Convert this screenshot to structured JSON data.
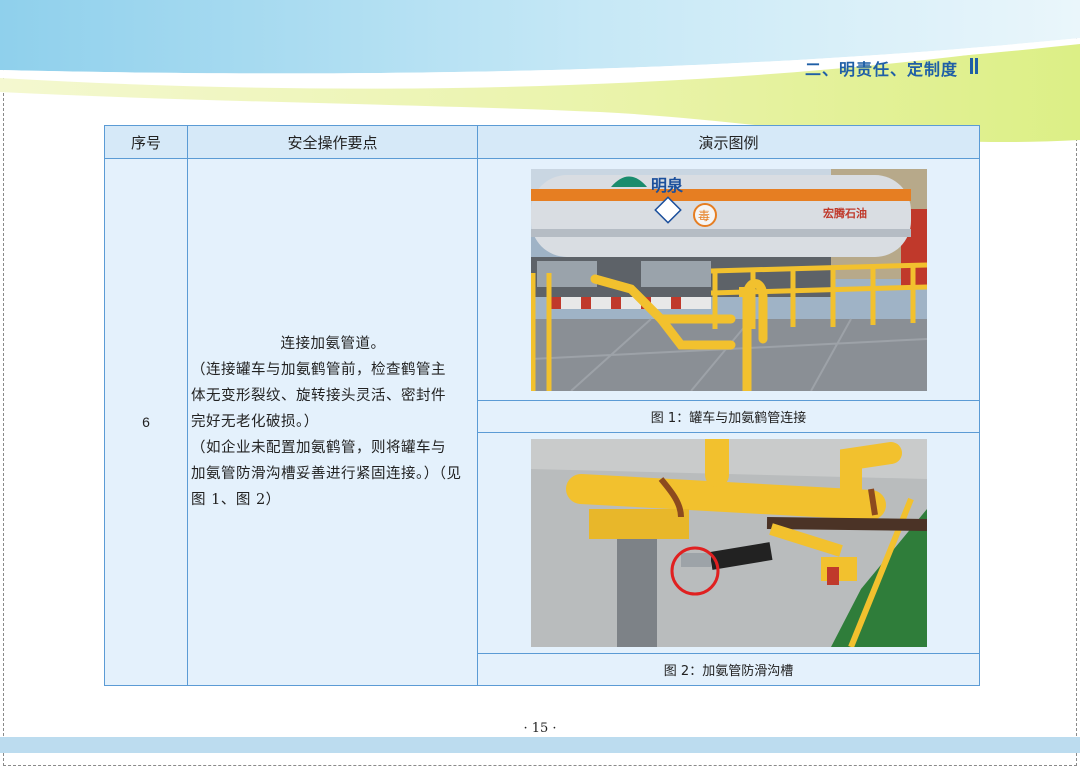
{
  "header": {
    "section_title": "二、明责任、定制度"
  },
  "table": {
    "headers": {
      "no": "序号",
      "points": "安全操作要点",
      "demo": "演示图例"
    },
    "row": {
      "no": "6",
      "points_title": "连接加氨管道。",
      "points_lines": [
        "（连接罐车与加氨鹤管前，检查鹤管主",
        "体无变形裂纹、旋转接头灵活、密封件",
        "完好无老化破损。）",
        "（如企业未配置加氨鹤管，则将罐车与",
        "加氨管防滑沟槽妥善进行紧固连接。）（见",
        "图 1、图 2）"
      ],
      "figure1": {
        "caption": "图 1：罐车与加氨鹤管连接",
        "tank_logo": "明泉",
        "hazard_text": "毒",
        "company_text": "宏腾石油"
      },
      "figure2": {
        "caption": "图 2：加氨管防滑沟槽"
      }
    }
  },
  "page_number": "· 15 ·",
  "colors": {
    "accent": "#1f5fa6",
    "border": "#5b9bd5",
    "header_bg": "#d6e9f8",
    "cell_bg": "#e4f1fc",
    "pipe_yellow": "#f2c12e"
  }
}
